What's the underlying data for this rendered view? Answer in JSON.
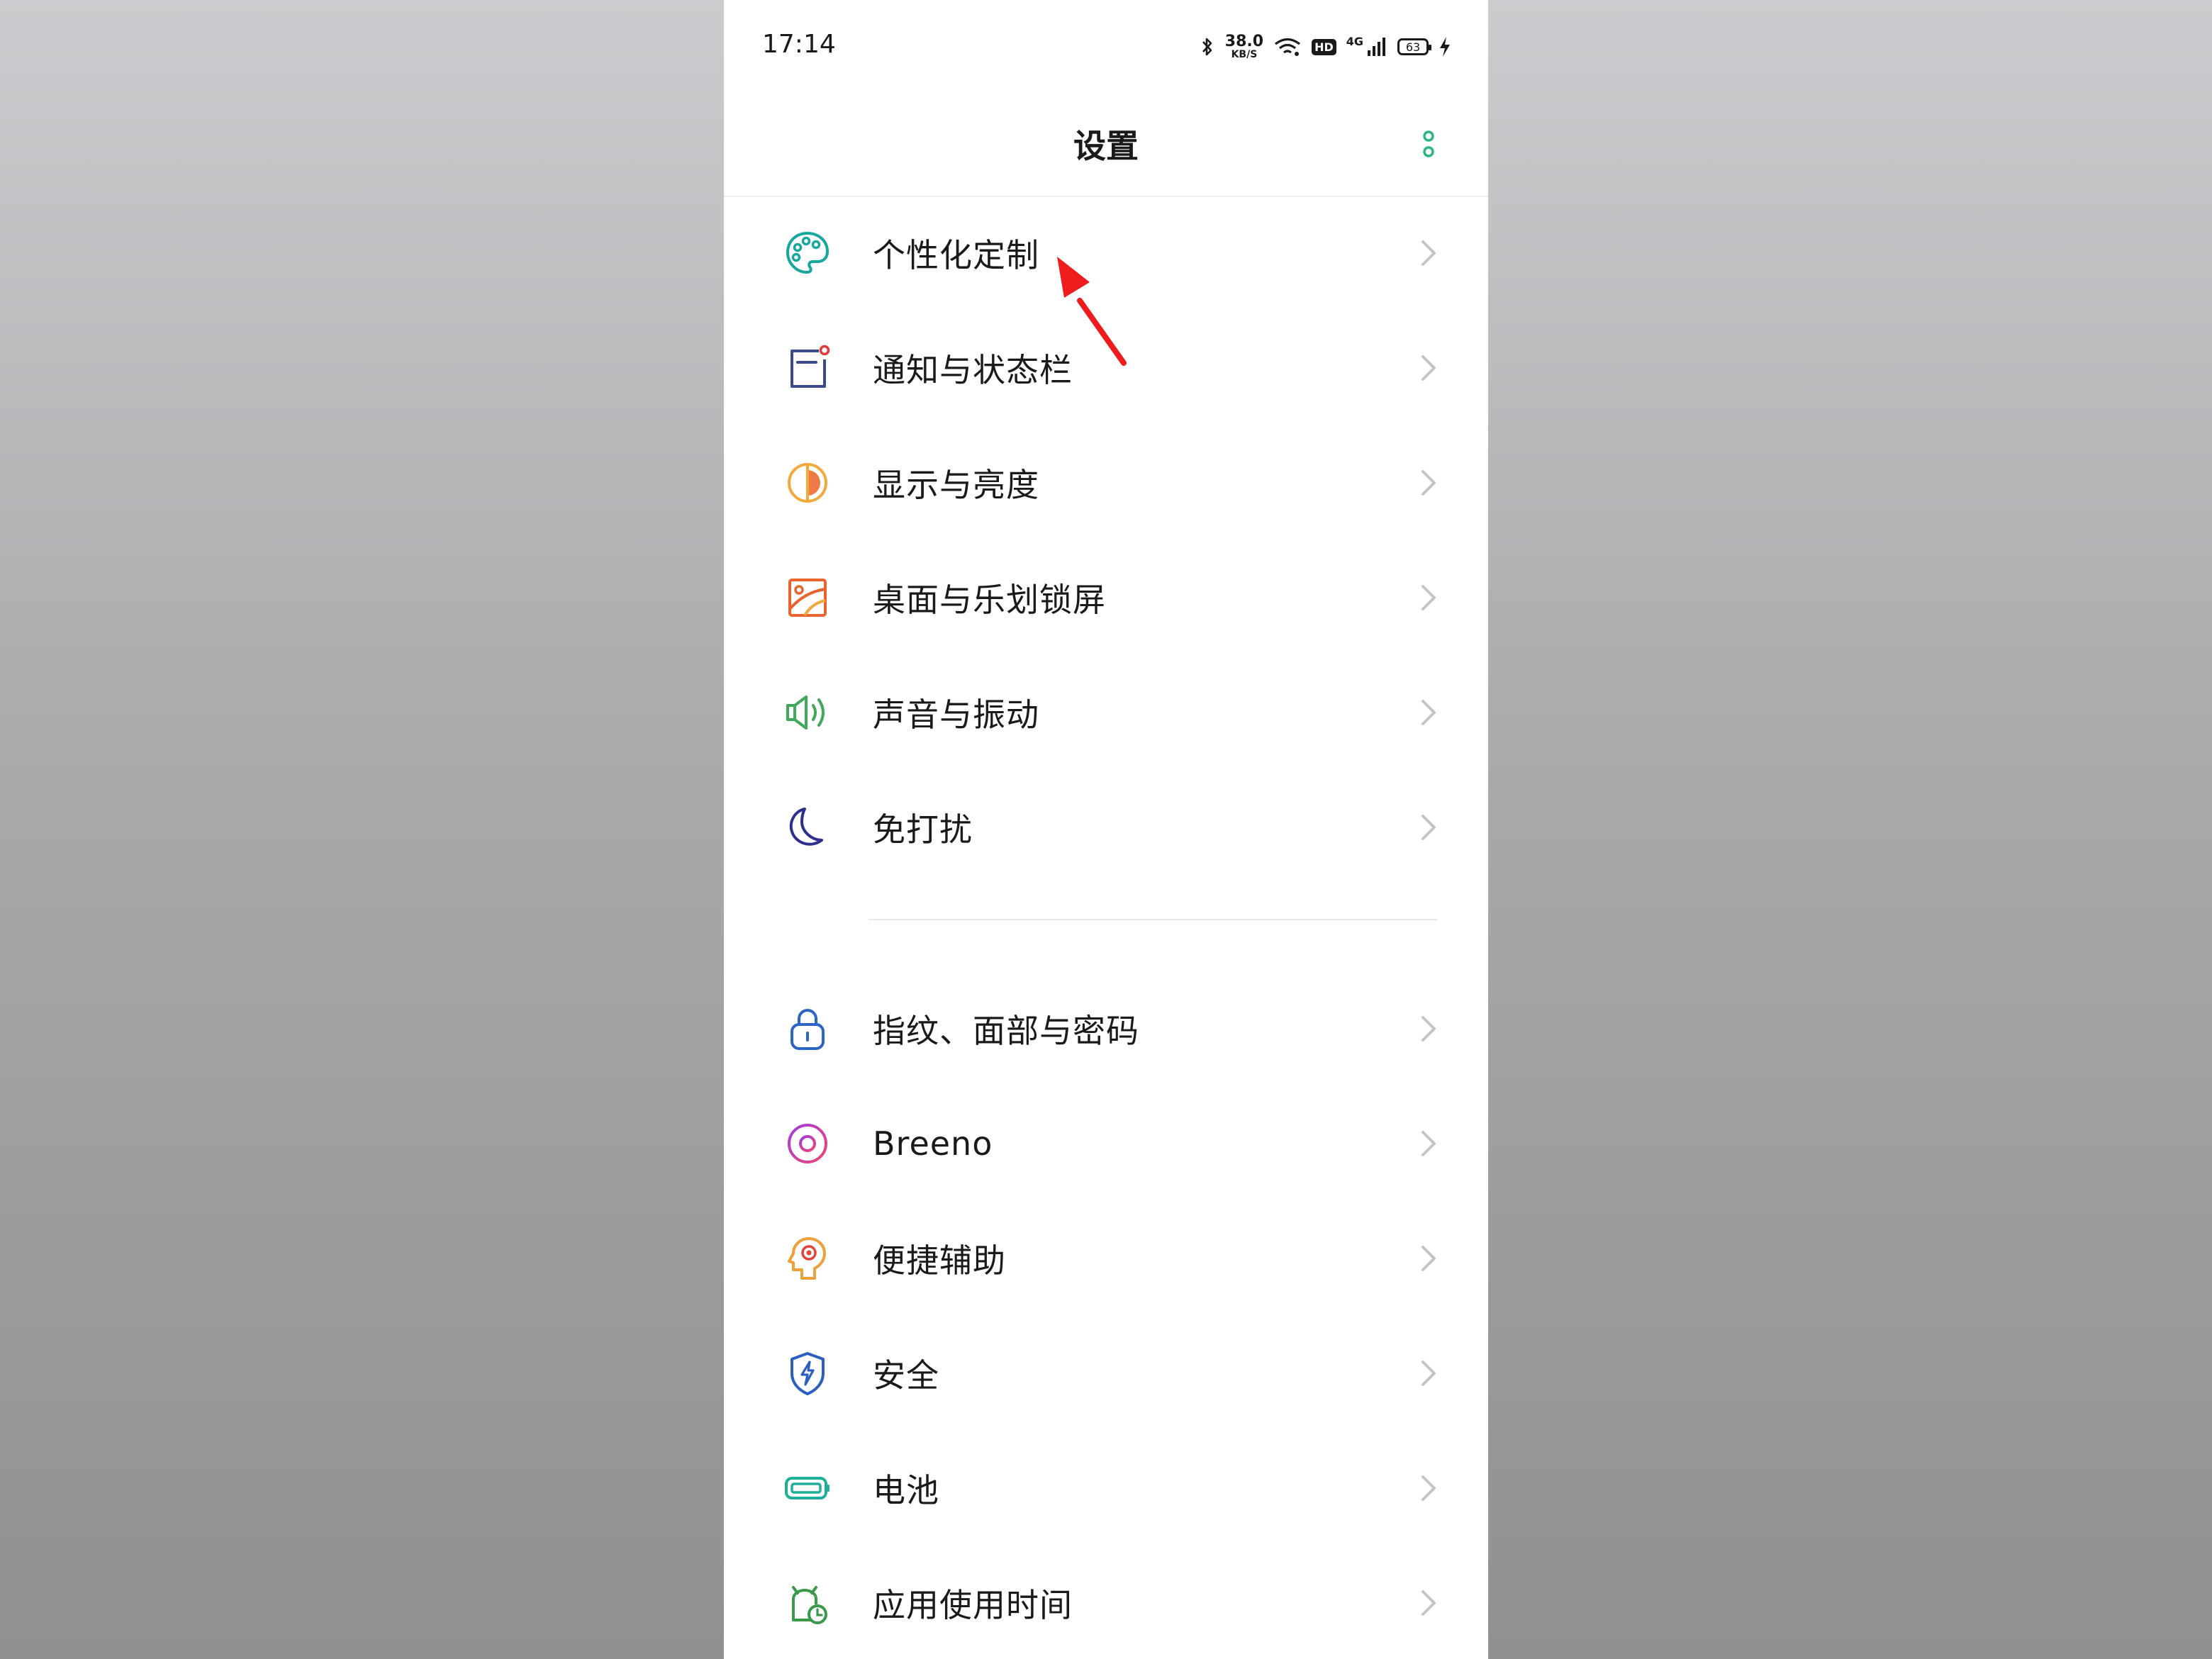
{
  "status_bar": {
    "time": "17:14",
    "speed_value": "38.0",
    "speed_unit": "KB/S",
    "hd": "HD",
    "network": "4G",
    "battery": "63"
  },
  "header": {
    "title": "设置"
  },
  "group1": [
    {
      "label": "个性化定制",
      "icon": "palette-icon"
    },
    {
      "label": "通知与状态栏",
      "icon": "notification-icon"
    },
    {
      "label": "显示与亮度",
      "icon": "brightness-icon"
    },
    {
      "label": "桌面与乐划锁屏",
      "icon": "wallpaper-icon"
    },
    {
      "label": "声音与振动",
      "icon": "speaker-icon"
    },
    {
      "label": "免打扰",
      "icon": "moon-icon"
    }
  ],
  "group2": [
    {
      "label": "指纹、面部与密码",
      "icon": "lock-icon"
    },
    {
      "label": "Breeno",
      "icon": "breeno-icon"
    },
    {
      "label": "便捷辅助",
      "icon": "assist-icon"
    },
    {
      "label": "安全",
      "icon": "shield-icon"
    },
    {
      "label": "电池",
      "icon": "battery-icon"
    },
    {
      "label": "应用使用时间",
      "icon": "app-time-icon"
    }
  ],
  "colors": {
    "accent": "#2ab77b",
    "annotation_arrow": "#ee1c1c",
    "text": "#1a1a1a"
  }
}
